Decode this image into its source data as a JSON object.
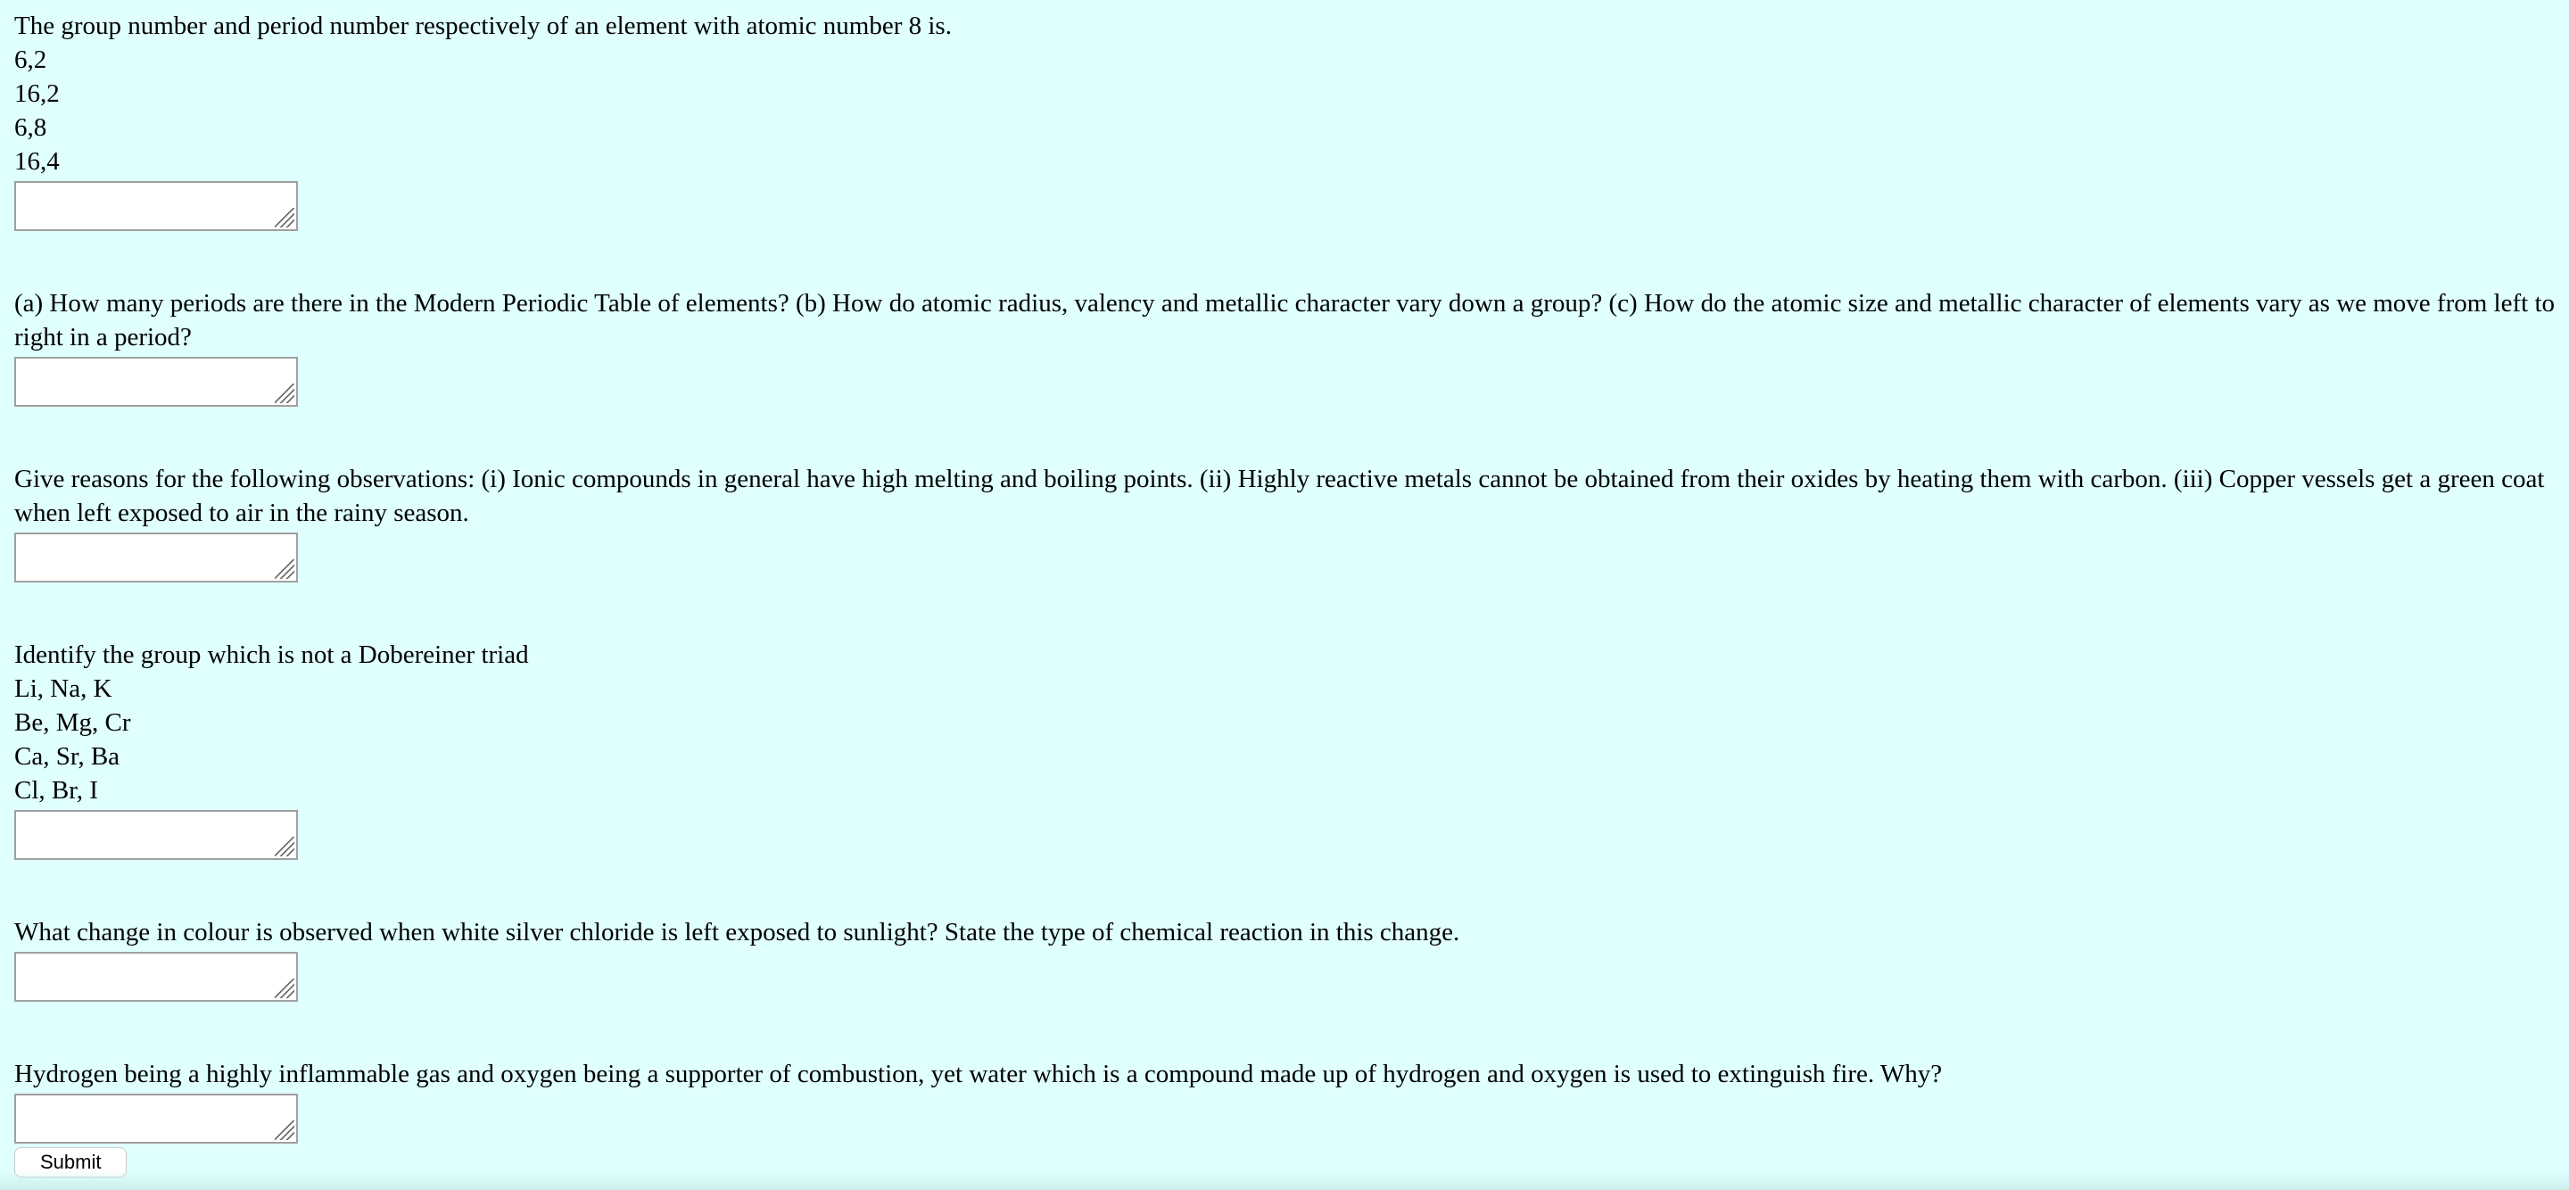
{
  "questions": [
    {
      "text": "The group number and period number respectively of an element with atomic number 8 is.",
      "options": [
        "6,2",
        "16,2",
        "6,8",
        "16,4"
      ]
    },
    {
      "text": "(a) How many periods are there in the Modern Periodic Table of elements? (b) How do atomic radius, valency and metallic character vary down a group? (c) How do the atomic size and metallic character of elements vary as we move from left to right in a period?",
      "options": []
    },
    {
      "text": "Give reasons for the following observations: (i) Ionic compounds in general have high melting and boiling points. (ii) Highly reactive metals cannot be obtained from their oxides by heating them with carbon. (iii) Copper vessels get a green coat when left exposed to air in the rainy season.",
      "options": []
    },
    {
      "text": "Identify the group which is not a Dobereiner triad",
      "options": [
        "Li, Na, K",
        "Be, Mg, Cr",
        "Ca, Sr, Ba",
        "Cl, Br, I"
      ]
    },
    {
      "text": "What change in colour is observed when white silver chloride is left exposed to sunlight? State the type of chemical reaction in this change.",
      "options": []
    },
    {
      "text": "Hydrogen being a highly inflammable gas and oxygen being a supporter of combustion, yet water which is a compound made up of hydrogen and oxygen is used to extinguish fire. Why?",
      "options": []
    }
  ],
  "form": {
    "submit_label": "Submit"
  },
  "colors": {
    "background": "#e0ffff",
    "input_border": "#a0a0a0"
  }
}
